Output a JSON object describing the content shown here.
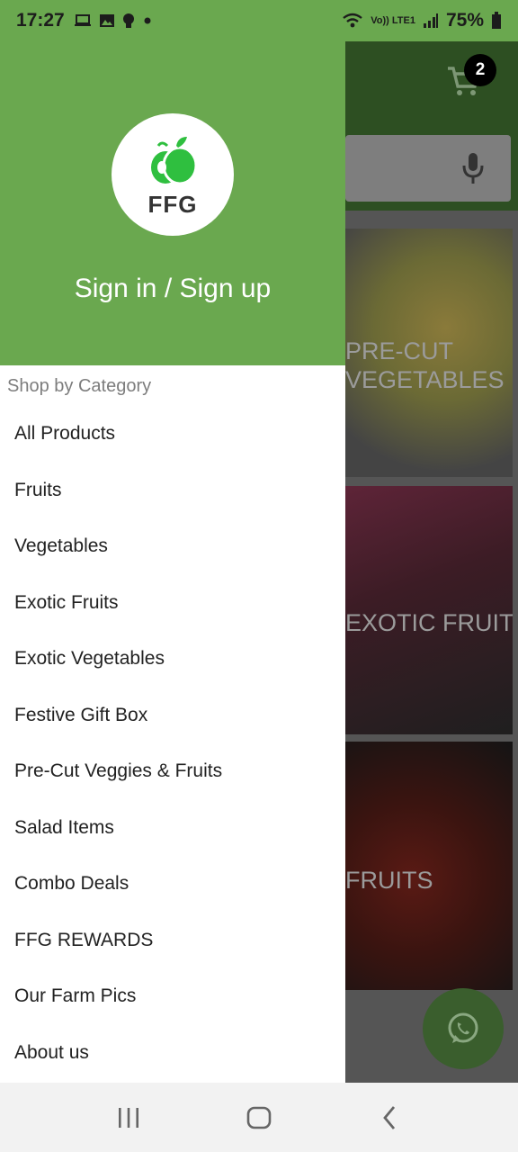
{
  "status_bar": {
    "time": "17:27",
    "battery": "75%",
    "network": "Vo)) LTE1",
    "icons": [
      "laptop-icon",
      "image-icon",
      "bulb-icon",
      "dot-icon",
      "wifi-icon",
      "signal-icon",
      "battery-icon"
    ]
  },
  "drawer": {
    "logo_text": "FFG",
    "signin_label": "Sign in / Sign up",
    "section_title": "Shop by Category",
    "items": [
      {
        "label": "All Products"
      },
      {
        "label": "Fruits"
      },
      {
        "label": "Vegetables"
      },
      {
        "label": "Exotic Fruits"
      },
      {
        "label": "Exotic Vegetables"
      },
      {
        "label": "Festive Gift Box"
      },
      {
        "label": "Pre-Cut Veggies & Fruits"
      },
      {
        "label": "Salad Items"
      },
      {
        "label": "Combo Deals"
      },
      {
        "label": "FFG REWARDS"
      },
      {
        "label": "Our Farm Pics"
      },
      {
        "label": "About us"
      }
    ]
  },
  "background": {
    "cart_count": "2",
    "tiles": [
      {
        "line1": "PRE-CUT",
        "line2": "VEGETABLES"
      },
      {
        "line1": "EXOTIC FRUITS"
      },
      {
        "line1": "FRUITS"
      }
    ]
  },
  "colors": {
    "brand_green": "#6aa84f",
    "header_dim": "#2d4f22",
    "fab_dim": "#3a5e2d"
  }
}
